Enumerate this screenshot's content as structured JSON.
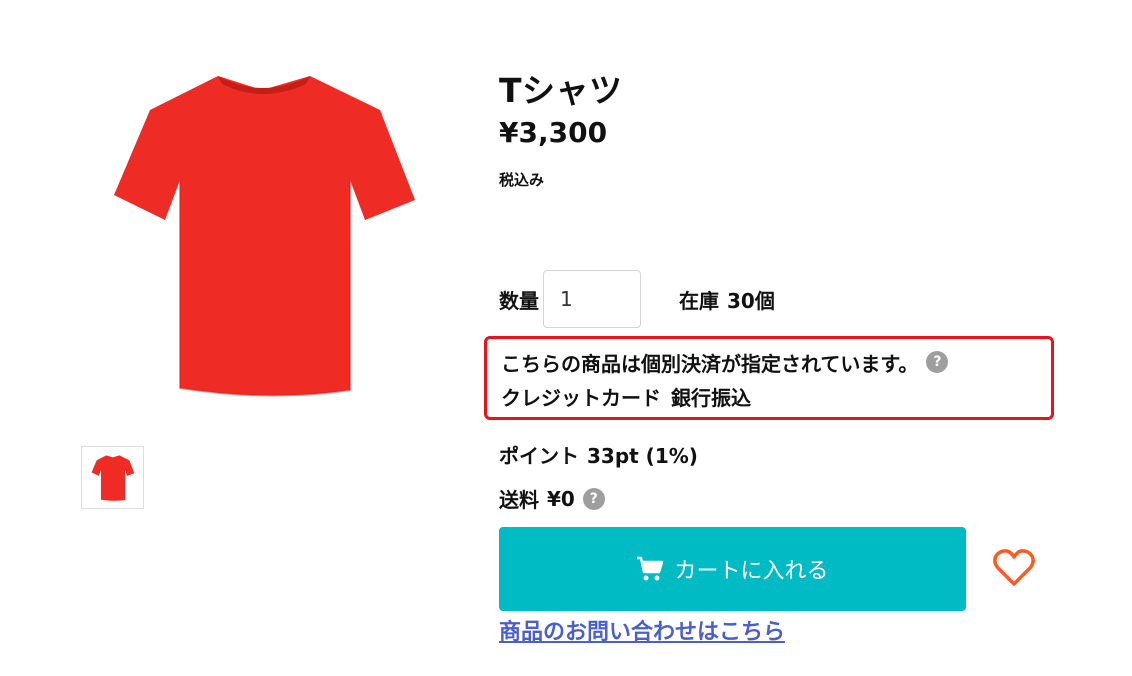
{
  "product": {
    "title": "Tシャツ",
    "price": "¥3,300",
    "tax_note": "税込み",
    "image_icon": "red-tshirt",
    "color": "#ee2b24"
  },
  "quantity": {
    "label": "数量",
    "value": "1"
  },
  "stock": {
    "label": "在庫",
    "value": "30個"
  },
  "payment": {
    "notice": "こちらの商品は個別決済が指定されています。",
    "methods": [
      "クレジットカード",
      "銀行振込"
    ],
    "help_icon": "?"
  },
  "points": {
    "label": "ポイント",
    "value": "33pt (1%)"
  },
  "shipping": {
    "label": "送料",
    "value": "¥0",
    "help_icon": "?"
  },
  "cart": {
    "label": "カートに入れる",
    "icon": "cart-icon",
    "color": "#00bac4"
  },
  "favorite": {
    "icon": "heart-icon",
    "color": "#ff5a1f"
  },
  "contact": {
    "label": "商品のお問い合わせはこちら"
  },
  "colors": {
    "highlight_border": "#e8131b",
    "link": "#4b5fcb"
  }
}
